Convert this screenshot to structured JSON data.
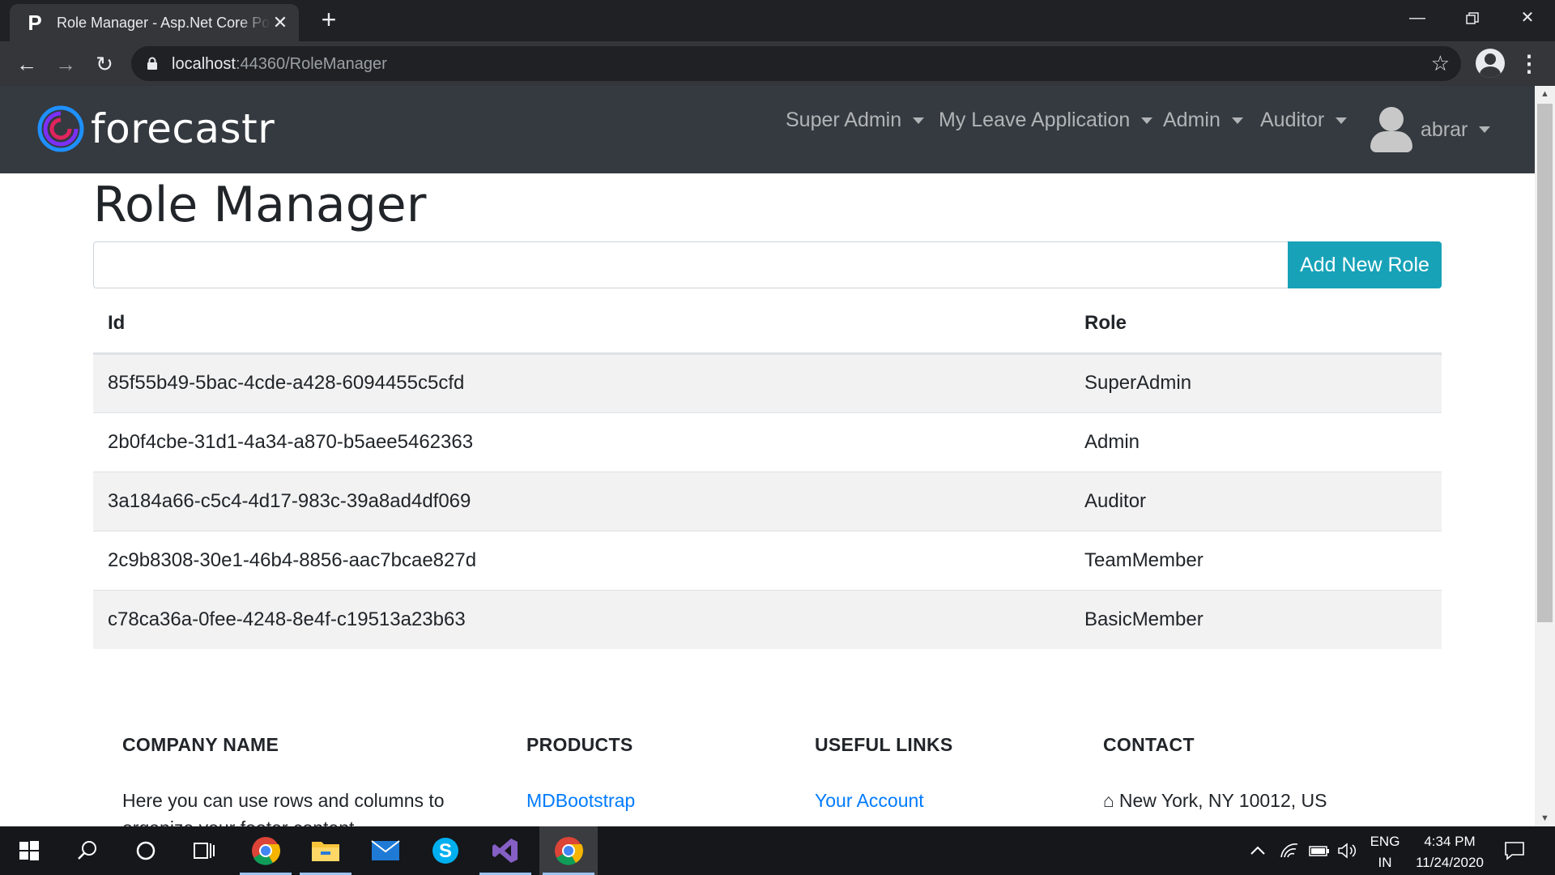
{
  "browser": {
    "tab_title": "Role Manager - Asp.Net Core Portal",
    "tab_favicon": "P",
    "url_host": "localhost",
    "url_rest": ":44360/RoleManager"
  },
  "navbar": {
    "brand": "forecastr",
    "menus": [
      {
        "label": "Super Admin"
      },
      {
        "label": "My Leave Application"
      },
      {
        "label": "Admin"
      },
      {
        "label": "Auditor"
      }
    ],
    "user": "abrar",
    "colors": {
      "bg": "#343a40",
      "logo_ring": "#1e90ff",
      "logo_inner": "#e0245e"
    }
  },
  "page": {
    "title": "Role Manager",
    "input_value": "",
    "add_button": "Add New Role",
    "table": {
      "headers": [
        "Id",
        "Role"
      ],
      "rows": [
        {
          "id": "85f55b49-5bac-4cde-a428-6094455c5cfd",
          "role": "SuperAdmin"
        },
        {
          "id": "2b0f4cbe-31d1-4a34-a870-b5aee5462363",
          "role": "Admin"
        },
        {
          "id": "3a184a66-c5c4-4d17-983c-39a8ad4df069",
          "role": "Auditor"
        },
        {
          "id": "2c9b8308-30e1-46b4-8856-aac7bcae827d",
          "role": "TeamMember"
        },
        {
          "id": "c78ca36a-0fee-4248-8e4f-c19513a23b63",
          "role": "BasicMember"
        }
      ]
    }
  },
  "footer": {
    "company": {
      "heading": "COMPANY NAME",
      "text": "Here you can use rows and columns to organize your footer content."
    },
    "products": {
      "heading": "PRODUCTS",
      "link": "MDBootstrap"
    },
    "useful_links": {
      "heading": "USEFUL LINKS",
      "link": "Your Account"
    },
    "contact": {
      "heading": "CONTACT",
      "address": "New York, NY 10012, US"
    }
  },
  "taskbar": {
    "apps": [
      "start-icon",
      "search-icon",
      "cortana-icon",
      "task-view-icon",
      "chrome-icon",
      "file-explorer-icon",
      "mail-icon",
      "skype-icon",
      "visual-studio-icon",
      "chrome-active-icon"
    ],
    "lang_top": "ENG",
    "lang_bottom": "IN",
    "time": "4:34 PM",
    "date": "11/24/2020"
  }
}
